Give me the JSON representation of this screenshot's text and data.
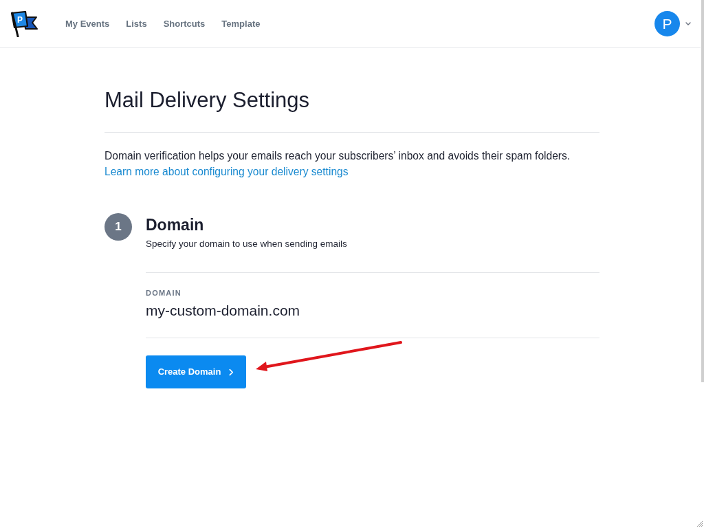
{
  "header": {
    "logo": {
      "letter": "P"
    },
    "nav": [
      "My Events",
      "Lists",
      "Shortcuts",
      "Template"
    ],
    "user_menu": {
      "avatar_initial": "P"
    }
  },
  "page": {
    "title": "Mail Delivery Settings",
    "intro": "Domain verification helps your emails reach your subscribers’ inbox and avoids their spam folders.",
    "link": "Learn more about configuring your delivery settings"
  },
  "steps": [
    {
      "number": "1",
      "title": "Domain",
      "description": "Specify your domain to use when sending emails",
      "field": {
        "label": "DOMAIN",
        "value": "my-custom-domain.com"
      },
      "button": "Create Domain"
    }
  ]
}
